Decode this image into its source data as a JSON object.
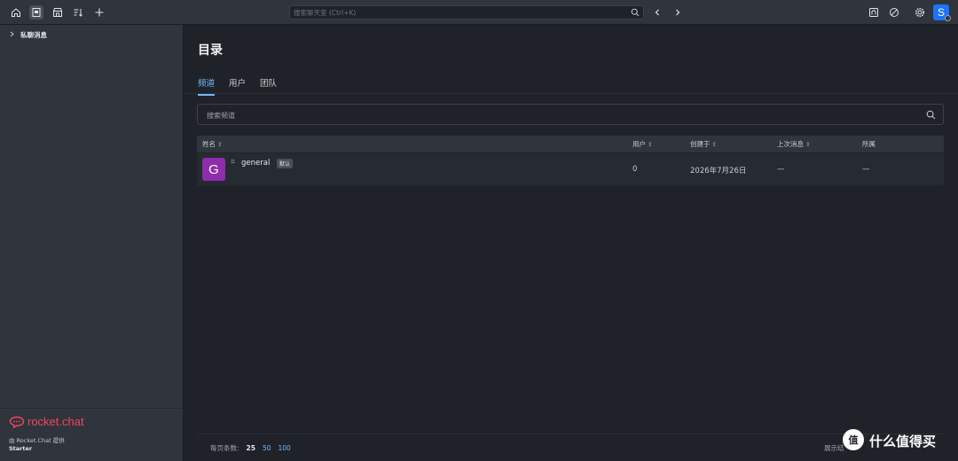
{
  "topbar": {
    "icons": [
      "home-icon",
      "directory-icon",
      "marketplace-icon",
      "sort-icon",
      "plus-icon"
    ],
    "search_placeholder": "搜索聊天室 (Ctrl+K)",
    "right_icons": [
      "audio-icon",
      "pen-off-icon",
      "gear-icon"
    ],
    "avatar_letter": "S",
    "colors": {
      "avatar": "#1d74f5"
    }
  },
  "sidebar": {
    "section_label": "私聊消息",
    "brand": "rocket.chat",
    "powered_by": "由 Rocket.Chat 提供",
    "plan": "Starter"
  },
  "main": {
    "title": "目录",
    "tabs": [
      {
        "label": "频道",
        "active": true
      },
      {
        "label": "用户",
        "active": false
      },
      {
        "label": "团队",
        "active": false
      }
    ],
    "filter_placeholder": "搜索频道",
    "columns": {
      "name": "姓名",
      "users": "用户",
      "created": "创建于",
      "last_message": "上次消息",
      "belongs": "所属"
    },
    "rows": [
      {
        "avatar_letter": "G",
        "avatar_color": "#8e2cad",
        "hash": "⌗",
        "name": "general",
        "badge": "默认",
        "users": "0",
        "created": "2026年7月26日",
        "last_message": "—",
        "belongs": "—"
      }
    ],
    "footer": {
      "per_page_label": "每页条数:",
      "per_page_options": [
        "25",
        "50",
        "100"
      ],
      "showing": "展示结"
    }
  },
  "watermark": {
    "badge": "值",
    "text": "什么值得买"
  }
}
